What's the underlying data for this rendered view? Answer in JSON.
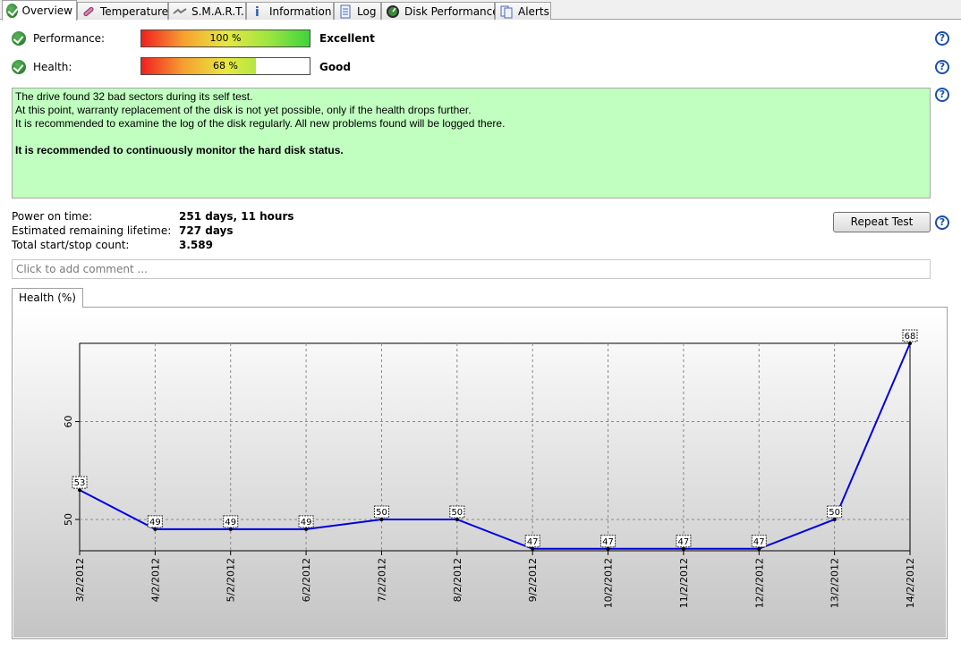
{
  "tabs": [
    {
      "label": "Overview",
      "icon": "check-circle-icon",
      "active": true
    },
    {
      "label": "Temperature",
      "icon": "thermometer-icon",
      "active": false
    },
    {
      "label": "S.M.A.R.T.",
      "icon": "smart-icon",
      "active": false
    },
    {
      "label": "Information",
      "icon": "info-icon",
      "active": false
    },
    {
      "label": "Log",
      "icon": "log-icon",
      "active": false
    },
    {
      "label": "Disk Performance",
      "icon": "gauge-icon",
      "active": false
    },
    {
      "label": "Alerts",
      "icon": "alerts-icon",
      "active": false
    }
  ],
  "performance": {
    "label": "Performance:",
    "percent_text": "100 %",
    "value": 100,
    "status": "Excellent"
  },
  "health": {
    "label": "Health:",
    "percent_text": "68 %",
    "value": 68,
    "status": "Good"
  },
  "message": {
    "lines": [
      "The drive found 32 bad sectors during its self test.",
      "At this point, warranty replacement of the disk is not yet possible, only if the health drops further.",
      "It is recommended to examine the log of the disk regularly. All new problems found will be logged there."
    ],
    "bold_line": "It is recommended to continuously monitor the hard disk status."
  },
  "info": {
    "power_on_label": "Power on time:",
    "power_on_value": "251 days, 11 hours",
    "lifetime_label": "Estimated remaining lifetime:",
    "lifetime_value": "727 days",
    "startstop_label": "Total start/stop count:",
    "startstop_value": "3.589"
  },
  "repeat_test_label": "Repeat Test",
  "help_glyph": "?",
  "comment_placeholder": "Click to add comment ...",
  "chart_tab_label": "Health (%)",
  "colors": {
    "line": "#0000e0",
    "message_bg": "#c0ffc0"
  },
  "chart_data": {
    "type": "line",
    "x": [
      "3/2/2012",
      "4/2/2012",
      "5/2/2012",
      "6/2/2012",
      "7/2/2012",
      "8/2/2012",
      "9/2/2012",
      "10/2/2012",
      "11/2/2012",
      "12/2/2012",
      "13/2/2012",
      "14/2/2012"
    ],
    "series": [
      {
        "values": [
          53,
          49,
          49,
          49,
          50,
          50,
          47,
          47,
          47,
          47,
          50,
          68
        ]
      }
    ],
    "yticks": [
      50,
      60
    ],
    "ylim": [
      46.8,
      68
    ],
    "grid": true,
    "data_labels": true,
    "legend": "none"
  }
}
